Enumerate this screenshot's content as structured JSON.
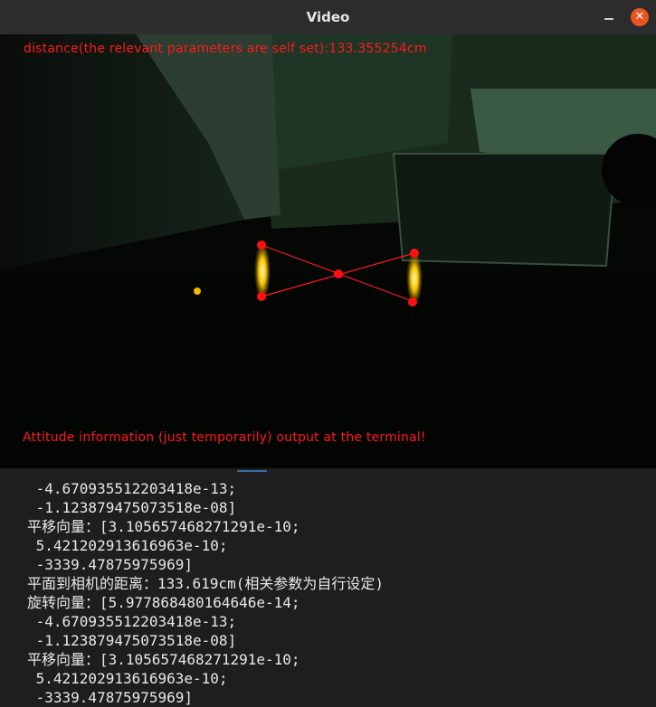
{
  "window": {
    "title": "Video",
    "minimize_icon": "minimize-icon",
    "close_icon": "close-icon",
    "close_glyph": "✕"
  },
  "video": {
    "distance_text": "distance(the relevant parameters are self set):133.355254cm",
    "attitude_text": "Attitude information (just temporarily) output at the terminal!",
    "overlay_color": "#ff1a1a"
  },
  "terminal": {
    "lines": [
      " -4.670935512203418e-13;",
      " -1.123879475073518e-08]",
      "平移向量：[3.105657468271291e-10;",
      " 5.421202913616963e-10;",
      " -3339.47875975969]",
      "平面到相机的距离：133.619cm(相关参数为自行设定)",
      "旋转向量：[5.977868480164646e-14;",
      " -4.670935512203418e-13;",
      " -1.123879475073518e-08]",
      "平移向量：[3.105657468271291e-10;",
      " 5.421202913616963e-10;",
      " -3339.47875975969]"
    ]
  }
}
